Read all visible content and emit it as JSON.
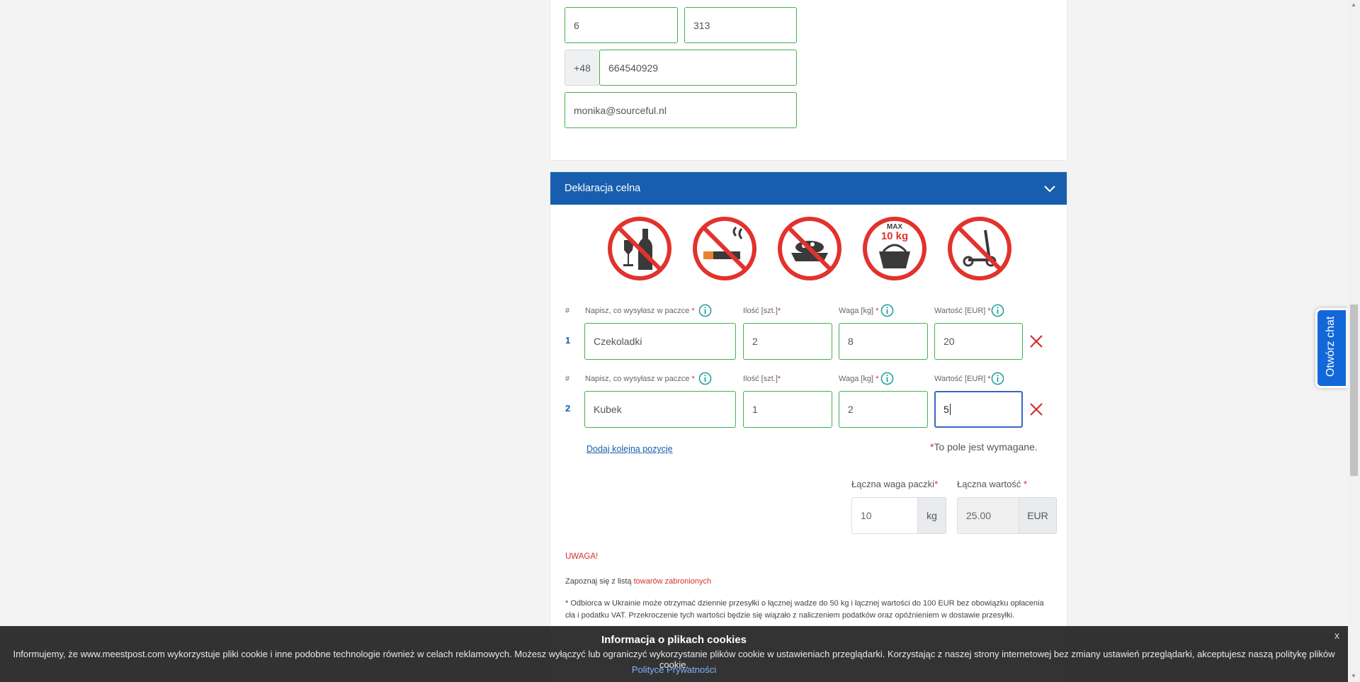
{
  "address": {
    "house_no": "6",
    "flat_no": "313",
    "phone_prefix": "+48",
    "phone": "664540929",
    "email": "monika@sourceful.nl"
  },
  "customs": {
    "section_title": "Deklaracja celna",
    "prohibited_icons": [
      "no-alcohol-icon",
      "no-cigarettes-icon",
      "no-food-icon",
      "max-10kg-basket-icon",
      "no-scooter-icon"
    ],
    "prohibited_max_label": "MAX",
    "prohibited_max_weight": "10 kg",
    "columns": {
      "hash": "#",
      "description": "Napisz, co wysyłasz w paczce",
      "quantity": "Ilość [szt.]",
      "weight": "Waga [kg]",
      "value": "Wartość [EUR]",
      "required_mark": "*"
    },
    "items": [
      {
        "num": "1",
        "description": "Czekoladki",
        "quantity": "2",
        "weight": "8",
        "value": "20"
      },
      {
        "num": "2",
        "description": "Kubek",
        "quantity": "1",
        "weight": "2",
        "value": "5"
      }
    ],
    "add_item_link": "Dodaj kolejną pozycję",
    "required_note_mark": "*",
    "required_note": "To pole jest wymagane.",
    "total_weight_label": "Łączna waga paczki",
    "total_weight": "10",
    "total_weight_unit": "kg",
    "total_value_label": "Łączna wartość",
    "total_value": "25.00",
    "total_value_unit": "EUR",
    "warning_title": "UWAGA!",
    "prohibited_prefix": "Zapoznaj się z listą ",
    "prohibited_link": "towarów zabronionych",
    "ukraine_note_line1": "* Odbiorca w Ukrainie może otrzymać dziennie przesyłki o łącznej wadze do 50 kg i łącznej wartości do 100 EUR bez obowiązku opłacenia",
    "ukraine_note_line2": "cła i podatku VAT. Przekroczenie tych wartości będzie się wiązało z naliczeniem podatków oraz opóźnieniem w dostawie przesyłki."
  },
  "chat": {
    "label": "Otwórz chat"
  },
  "cookie": {
    "title": "Informacja o plikach cookies",
    "text": "Informujemy, że www.meestpost.com wykorzystuje pliki cookie i inne podobne technologie również w celach reklamowych. Możesz wyłączyć lub ograniczyć wykorzystanie plików cookie w ustawieniach przeglądarki. Korzystając z naszej strony internetowej bez zmiany ustawień przeglądarki, akceptujesz naszą politykę plików cookie.",
    "link": "Polityce Prywatności",
    "close": "x"
  },
  "colors": {
    "brand_blue": "#175fae",
    "valid_green": "#43b049",
    "danger_red": "#d32f2f",
    "focus_blue": "#3b64c3"
  }
}
